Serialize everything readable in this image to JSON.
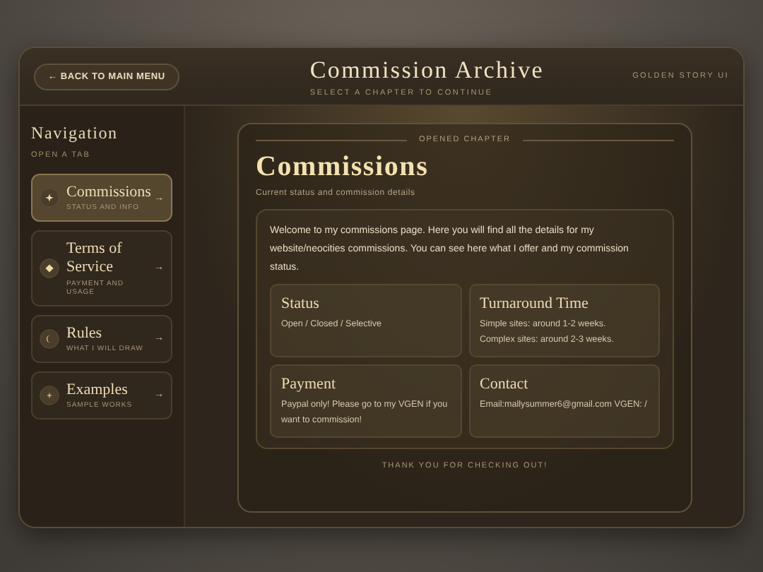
{
  "header": {
    "back_button": "← BACK TO MAIN MENU",
    "title": "Commission Archive",
    "subtitle": "SELECT A CHAPTER TO CONTINUE",
    "brand": "GOLDEN STORY UI"
  },
  "sidebar": {
    "title": "Navigation",
    "subtitle": "OPEN A TAB",
    "items": [
      {
        "label": "Commissions",
        "caption": "STATUS AND INFO",
        "arrow": "→",
        "kind": "sparkle",
        "selected": true
      },
      {
        "label": "Terms of Service",
        "caption": "PAYMENT AND USAGE",
        "arrow": "→",
        "kind": "diamond",
        "selected": false
      },
      {
        "label": "Rules",
        "caption": "WHAT I WILL DRAW",
        "arrow": "→",
        "kind": "moon",
        "selected": false
      },
      {
        "label": "Examples",
        "caption": "SAMPLE WORKS",
        "arrow": "→",
        "kind": "star",
        "selected": false
      }
    ]
  },
  "chapter": {
    "eyebrow": "OPENED CHAPTER",
    "title": "Commissions",
    "subtitle": "Current status and commission details",
    "intro": "Welcome to my commissions page. Here you will find all the details for my website/neocities commissions. You can see here what I offer and my commission status.",
    "cards": [
      {
        "title": "Status",
        "lines": [
          "Open / Closed / Selective"
        ]
      },
      {
        "title": "Turnaround Time",
        "lines": [
          "Simple sites: around 1-2 weeks.",
          "Complex sites: around 2-3 weeks."
        ]
      },
      {
        "title": "Payment",
        "lines": [
          "Paypal only! Please go to my VGEN if you want to commission!"
        ]
      },
      {
        "title": "Contact",
        "lines": [
          "Email:mallysummer6@gmail.com VGEN: /"
        ]
      }
    ],
    "footer": "THANK YOU FOR CHECKING OUT!"
  }
}
